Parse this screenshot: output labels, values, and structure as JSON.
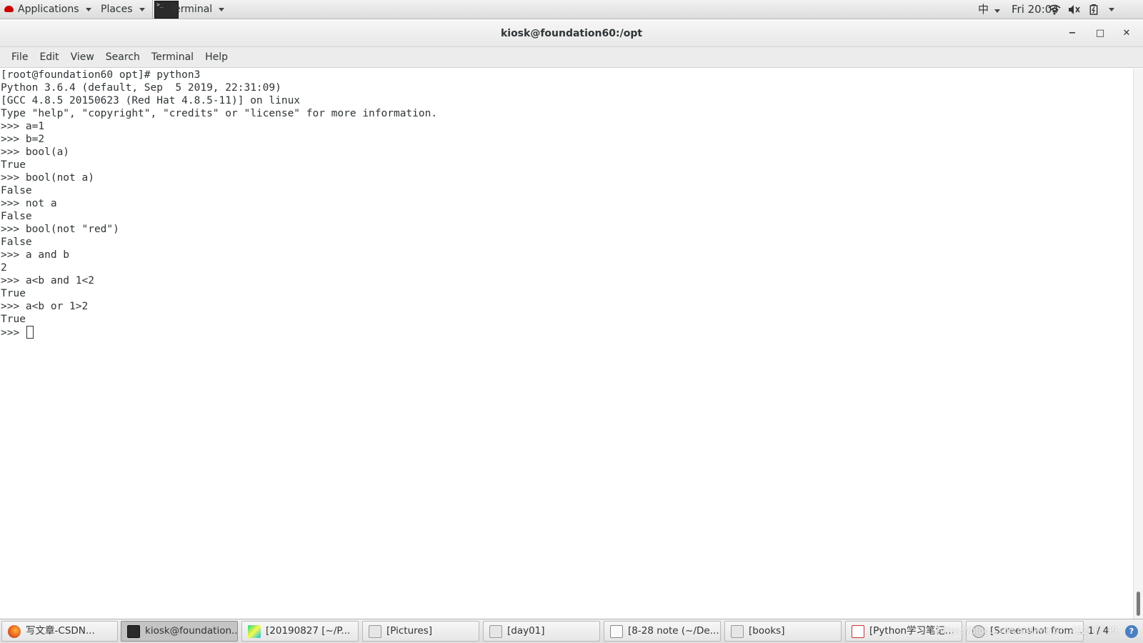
{
  "top_panel": {
    "applications": "Applications",
    "places": "Places",
    "terminal": "Terminal",
    "input_method": "中",
    "clock": "Fri 20:04",
    "icons": [
      "redhat-icon",
      "terminal-icon",
      "wifi-icon",
      "volume-icon",
      "battery-icon",
      "power-menu-icon"
    ]
  },
  "window": {
    "title": "kiosk@foundation60:/opt",
    "controls": [
      "minimize-icon",
      "maximize-icon",
      "close-icon"
    ]
  },
  "menu": [
    "File",
    "Edit",
    "View",
    "Search",
    "Terminal",
    "Help"
  ],
  "terminal": {
    "lines": [
      "[root@foundation60 opt]# python3",
      "Python 3.6.4 (default, Sep  5 2019, 22:31:09)",
      "[GCC 4.8.5 20150623 (Red Hat 4.8.5-11)] on linux",
      "Type \"help\", \"copyright\", \"credits\" or \"license\" for more information.",
      ">>> a=1",
      ">>> b=2",
      ">>> bool(a)",
      "True",
      ">>> bool(not a)",
      "False",
      ">>> not a",
      "False",
      ">>> bool(not \"red\")",
      "False",
      ">>> a and b",
      "2",
      ">>> a<b and 1<2",
      "True",
      ">>> a<b or 1>2",
      "True"
    ],
    "prompt": ">>> "
  },
  "taskbar": {
    "tasks": [
      {
        "label": "写文章-CSDN...",
        "icon": "firefox-icon"
      },
      {
        "label": "kiosk@foundation...",
        "icon": "terminal-icon"
      },
      {
        "label": "[20190827 [~/P...",
        "icon": "pycharm-icon"
      },
      {
        "label": "[Pictures]",
        "icon": "file-manager-icon"
      },
      {
        "label": "[day01]",
        "icon": "file-manager-icon"
      },
      {
        "label": "[8-28 note (~/De...",
        "icon": "text-editor-icon"
      },
      {
        "label": "[books]",
        "icon": "file-manager-icon"
      },
      {
        "label": "[Python学习笔记...",
        "icon": "document-viewer-icon"
      },
      {
        "label": "[Screenshot from ...",
        "icon": "image-viewer-icon"
      }
    ],
    "workspace": "1 / 4",
    "watermark": "https://blog.csdn.net/weixin_42266599"
  }
}
